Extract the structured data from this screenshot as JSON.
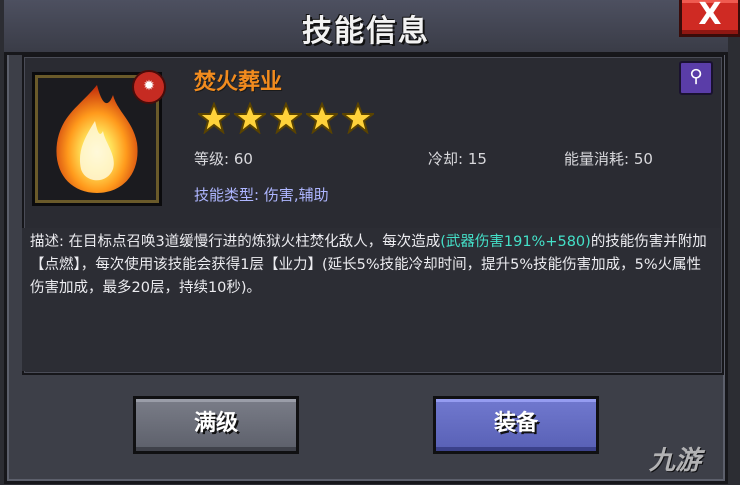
{
  "dialog": {
    "title": "技能信息",
    "close_label": "X"
  },
  "skill": {
    "name": "焚火葬业",
    "element_badge_icon": "flame-icon",
    "class_icon": "boot-icon",
    "stars": 5,
    "level_label": "等级: 60",
    "cooldown_label": "冷却: 15",
    "energy_label": "能量消耗: 50",
    "type_label": "技能类型: 伤害,辅助"
  },
  "description": {
    "part1": "描述: 在目标点召唤3道缓慢行进的炼狱火柱焚化敌人，每次造成",
    "highlight": "(武器伤害191%+580)",
    "part2": "的技能伤害并附加【点燃】，每次使用该技能会获得1层【业力】(延长5%技能冷却时间，提升5%技能伤害加成，5%火属性伤害加成，最多20层，持续10秒)。"
  },
  "buttons": {
    "max_level": "满级",
    "equip": "装备"
  },
  "watermark": "九游",
  "colors": {
    "skill_name": "#f28b1e",
    "highlight": "#44e0c8",
    "type_text": "#aeb6ff",
    "close_button": "#cf2a23",
    "equip_button": "#5860b5"
  }
}
